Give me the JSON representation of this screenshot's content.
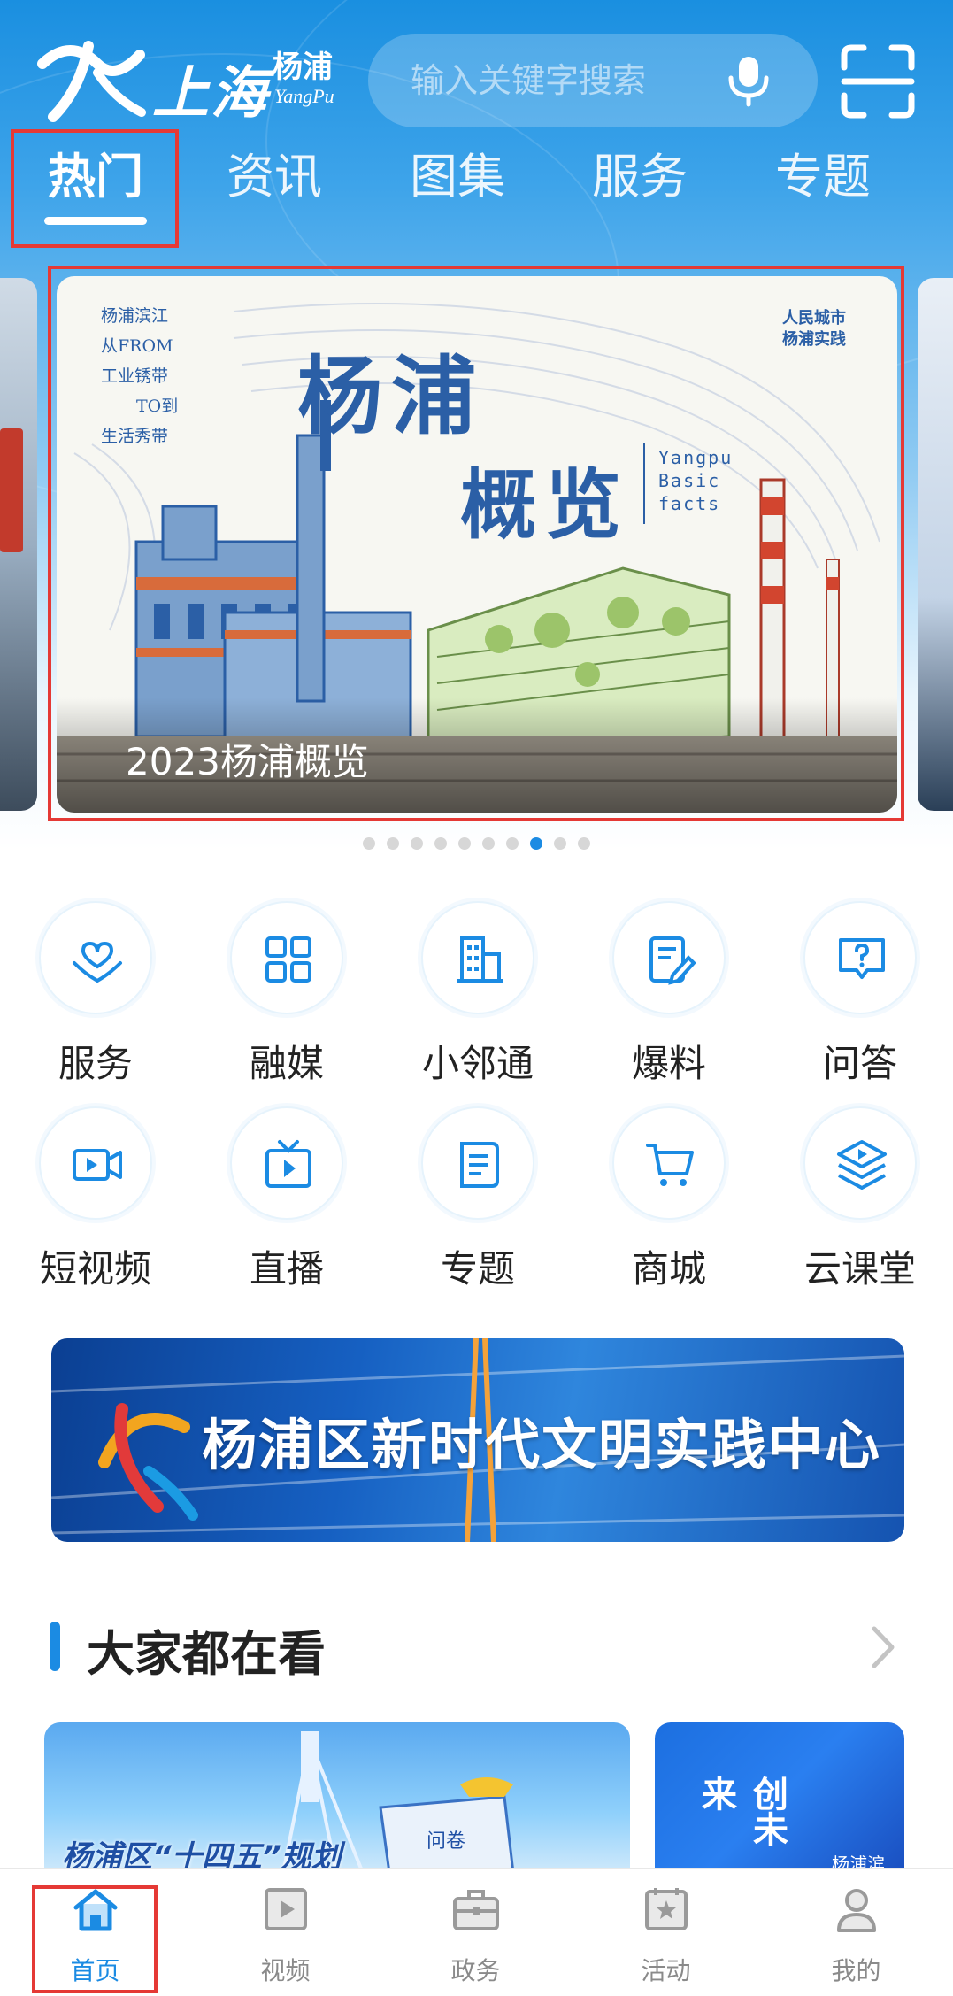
{
  "header": {
    "logo_city": "上海",
    "logo_district": "杨浦",
    "logo_english": "YangPu",
    "search_placeholder": "输入关键字搜索",
    "mic_icon": "microphone-icon",
    "scan_icon": "scan-icon"
  },
  "tabs": [
    {
      "label": "热门",
      "active": true
    },
    {
      "label": "资讯",
      "active": false
    },
    {
      "label": "图集",
      "active": false
    },
    {
      "label": "服务",
      "active": false
    },
    {
      "label": "专题",
      "active": false
    }
  ],
  "banner": {
    "caption": "2023杨浦概览",
    "title_line1": "杨浦",
    "title_line2": "概览",
    "english": [
      "Yangpu",
      "Basic",
      "facts"
    ],
    "poem": [
      "杨浦滨江",
      "从FROM",
      "工业锈带",
      "TO到",
      "生活秀带"
    ],
    "tag": [
      "人民城市",
      "杨浦实践"
    ],
    "page_count": 10,
    "active_index": 7
  },
  "grid": [
    {
      "label": "服务",
      "icon": "heart-hands-icon"
    },
    {
      "label": "融媒",
      "icon": "grid-apps-icon"
    },
    {
      "label": "小邻通",
      "icon": "building-icon"
    },
    {
      "label": "爆料",
      "icon": "edit-note-icon"
    },
    {
      "label": "问答",
      "icon": "question-bubble-icon"
    },
    {
      "label": "短视频",
      "icon": "video-camera-icon"
    },
    {
      "label": "直播",
      "icon": "tv-play-icon"
    },
    {
      "label": "专题",
      "icon": "document-icon"
    },
    {
      "label": "商城",
      "icon": "shopping-cart-icon"
    },
    {
      "label": "云课堂",
      "icon": "layers-play-icon"
    }
  ],
  "promo": {
    "text": "杨浦区新时代文明实践中心"
  },
  "section": {
    "title": "大家都在看",
    "card1_text": "杨浦区“十四五”规划",
    "card1_tag": "问卷",
    "card2_text": "创未来",
    "card2_sub": "杨浦滨"
  },
  "bottom_nav": [
    {
      "label": "首页",
      "icon": "home-icon",
      "active": true
    },
    {
      "label": "视频",
      "icon": "video-play-icon",
      "active": false
    },
    {
      "label": "政务",
      "icon": "briefcase-icon",
      "active": false
    },
    {
      "label": "活动",
      "icon": "star-badge-icon",
      "active": false
    },
    {
      "label": "我的",
      "icon": "user-icon",
      "active": false
    }
  ],
  "colors": {
    "accent": "#1b8be3",
    "highlight_box": "#e53935",
    "banner_ink": "#2b5fa6"
  }
}
